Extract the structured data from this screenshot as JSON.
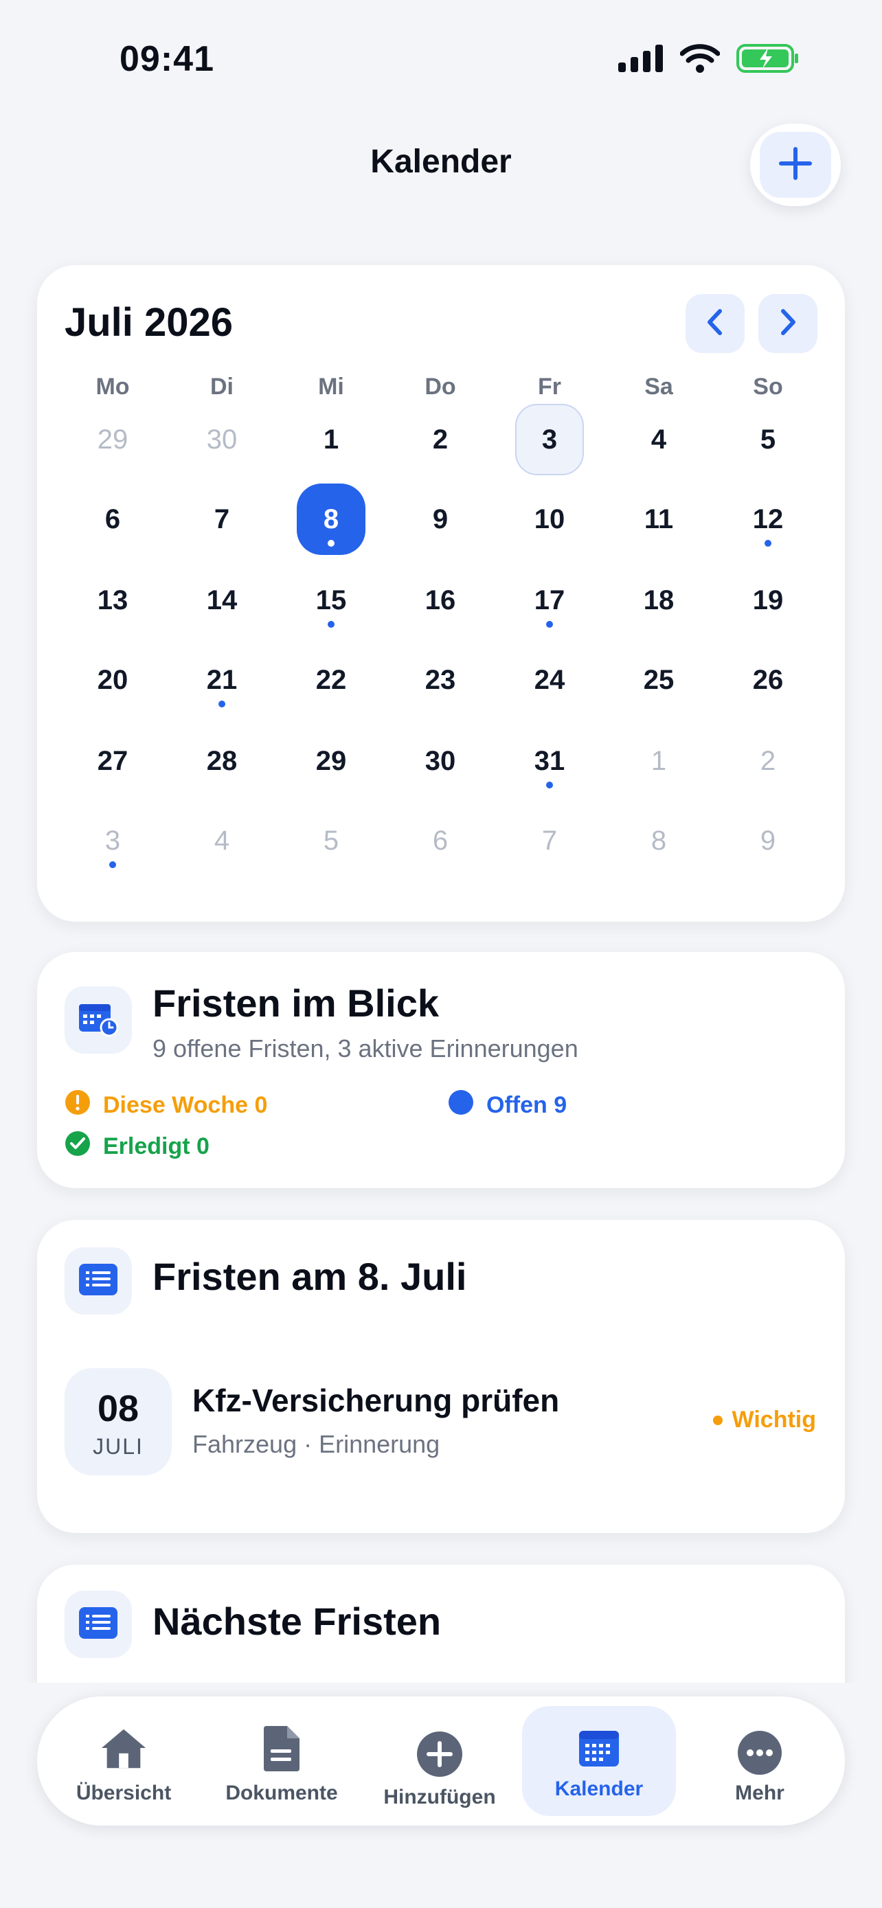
{
  "status_bar": {
    "time": "09:41"
  },
  "header": {
    "title": "Kalender"
  },
  "calendar": {
    "month_label": "Juli 2026",
    "weekdays": [
      "Mo",
      "Di",
      "Mi",
      "Do",
      "Fr",
      "Sa",
      "So"
    ],
    "weeks": [
      [
        {
          "d": "29",
          "m": true
        },
        {
          "d": "30",
          "m": true
        },
        {
          "d": "1"
        },
        {
          "d": "2"
        },
        {
          "d": "3",
          "today": true
        },
        {
          "d": "4"
        },
        {
          "d": "5"
        }
      ],
      [
        {
          "d": "6"
        },
        {
          "d": "7"
        },
        {
          "d": "8",
          "sel": true,
          "dot": true
        },
        {
          "d": "9"
        },
        {
          "d": "10"
        },
        {
          "d": "11"
        },
        {
          "d": "12",
          "dot": true
        }
      ],
      [
        {
          "d": "13"
        },
        {
          "d": "14"
        },
        {
          "d": "15",
          "dot": true
        },
        {
          "d": "16"
        },
        {
          "d": "17",
          "dot": true
        },
        {
          "d": "18"
        },
        {
          "d": "19"
        }
      ],
      [
        {
          "d": "20"
        },
        {
          "d": "21",
          "dot": true
        },
        {
          "d": "22"
        },
        {
          "d": "23"
        },
        {
          "d": "24"
        },
        {
          "d": "25"
        },
        {
          "d": "26"
        }
      ],
      [
        {
          "d": "27"
        },
        {
          "d": "28"
        },
        {
          "d": "29"
        },
        {
          "d": "30"
        },
        {
          "d": "31",
          "dot": true
        },
        {
          "d": "1",
          "m": true
        },
        {
          "d": "2",
          "m": true
        }
      ],
      [
        {
          "d": "3",
          "m": true,
          "dot": true
        },
        {
          "d": "4",
          "m": true
        },
        {
          "d": "5",
          "m": true
        },
        {
          "d": "6",
          "m": true
        },
        {
          "d": "7",
          "m": true
        },
        {
          "d": "8",
          "m": true
        },
        {
          "d": "9",
          "m": true
        }
      ]
    ]
  },
  "overview": {
    "title": "Fristen im Blick",
    "subtitle": "9 offene Fristen, 3 aktive Erinnerungen",
    "this_week": "Diese Woche 0",
    "open": "Offen 9",
    "done": "Erledigt 0"
  },
  "day_deadlines": {
    "title": "Fristen am 8. Juli",
    "items": [
      {
        "day": "08",
        "month": "JULI",
        "title": "Kfz-Versicherung prüfen",
        "subtitle": "Fahrzeug · Erinnerung",
        "badge": "Wichtig"
      }
    ]
  },
  "next_deadlines": {
    "title": "Nächste Fristen"
  },
  "tabbar": {
    "items": [
      {
        "label": "Übersicht",
        "icon": "home-icon"
      },
      {
        "label": "Dokumente",
        "icon": "document-icon"
      },
      {
        "label": "Hinzufügen",
        "icon": "plus-circle-icon"
      },
      {
        "label": "Kalender",
        "icon": "calendar-icon",
        "active": true
      },
      {
        "label": "Mehr",
        "icon": "more-icon"
      }
    ]
  },
  "colors": {
    "accent": "#2563eb",
    "warning": "#f59e0b",
    "success": "#16a34a",
    "background": "#f4f5f8"
  }
}
